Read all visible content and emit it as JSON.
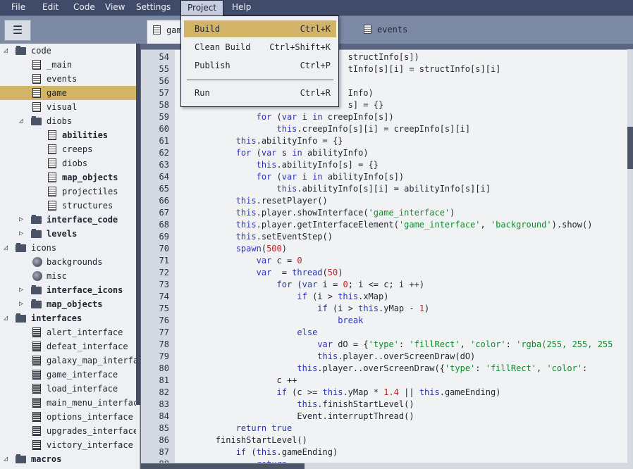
{
  "menubar": {
    "items": [
      "File",
      "Edit",
      "Code",
      "View",
      "Settings",
      "Project",
      "Help"
    ],
    "open": "Project"
  },
  "toolbar": {
    "menu_icon": "☰"
  },
  "tabs": [
    {
      "label": "gam"
    },
    {
      "label": "es"
    },
    {
      "label": "events"
    }
  ],
  "project_menu": {
    "items": [
      {
        "label": "Build",
        "shortcut": "Ctrl+K"
      },
      {
        "label": "Clean Build",
        "shortcut": "Ctrl+Shift+K"
      },
      {
        "label": "Publish",
        "shortcut": "Ctrl+P"
      },
      {
        "label": "Run",
        "shortcut": "Ctrl+R"
      }
    ]
  },
  "sidebar": {
    "items": [
      {
        "label": "code",
        "kind": "folder",
        "expanded": true,
        "bold": false
      },
      {
        "label": "_main",
        "kind": "file"
      },
      {
        "label": "events",
        "kind": "file"
      },
      {
        "label": "game",
        "kind": "file",
        "selected": true
      },
      {
        "label": "visual",
        "kind": "file"
      },
      {
        "label": "diobs",
        "kind": "folder",
        "expanded": true
      },
      {
        "label": "abilities",
        "kind": "file",
        "bold": true
      },
      {
        "label": "creeps",
        "kind": "file"
      },
      {
        "label": "diobs",
        "kind": "file"
      },
      {
        "label": "map_objects",
        "kind": "file",
        "bold": true
      },
      {
        "label": "projectiles",
        "kind": "file"
      },
      {
        "label": "structures",
        "kind": "file"
      },
      {
        "label": "interface_code",
        "kind": "folder",
        "expanded": false,
        "bold": true
      },
      {
        "label": "levels",
        "kind": "folder",
        "expanded": false,
        "bold": true
      },
      {
        "label": "icons",
        "kind": "folder",
        "expanded": true
      },
      {
        "label": "backgrounds",
        "kind": "image"
      },
      {
        "label": "misc",
        "kind": "image"
      },
      {
        "label": "interface_icons",
        "kind": "folder",
        "expanded": false,
        "bold": true
      },
      {
        "label": "map_objects",
        "kind": "folder",
        "expanded": false,
        "bold": true
      },
      {
        "label": "interfaces",
        "kind": "folder",
        "expanded": true,
        "bold": true
      },
      {
        "label": "alert_interface",
        "kind": "iface"
      },
      {
        "label": "defeat_interface",
        "kind": "iface"
      },
      {
        "label": "galaxy_map_interface",
        "kind": "iface"
      },
      {
        "label": "game_interface",
        "kind": "iface"
      },
      {
        "label": "load_interface",
        "kind": "iface"
      },
      {
        "label": "main_menu_interface",
        "kind": "iface"
      },
      {
        "label": "options_interface",
        "kind": "iface"
      },
      {
        "label": "upgrades_interface",
        "kind": "iface"
      },
      {
        "label": "victory_interface",
        "kind": "iface"
      },
      {
        "label": "macros",
        "kind": "folder",
        "expanded": true,
        "bold": true
      }
    ]
  },
  "editor": {
    "lines": [
      {
        "n": "54",
        "t": "                                  structInfo[s])"
      },
      {
        "n": "55",
        "t": "                                  tInfo[s][i] = structInfo[s][i]"
      },
      {
        "n": "56",
        "t": ""
      },
      {
        "n": "57",
        "t": "                                  Info)"
      },
      {
        "n": "58",
        "t": "                                  s] = {}"
      },
      {
        "n": "59",
        "t": "                for (var i in creepInfo[s])"
      },
      {
        "n": "60",
        "t": "                    this.creepInfo[s][i] = creepInfo[s][i]"
      },
      {
        "n": "61",
        "t": "            this.abilityInfo = {}"
      },
      {
        "n": "62",
        "t": "            for (var s in abilityInfo)"
      },
      {
        "n": "63",
        "t": "                this.abilityInfo[s] = {}"
      },
      {
        "n": "64",
        "t": "                for (var i in abilityInfo[s])"
      },
      {
        "n": "65",
        "t": "                    this.abilityInfo[s][i] = abilityInfo[s][i]"
      },
      {
        "n": "66",
        "t": "            this.resetPlayer()"
      },
      {
        "n": "67",
        "t": "            this.player.showInterface('game_interface')"
      },
      {
        "n": "68",
        "t": "            this.player.getInterfaceElement('game_interface', 'background').show()"
      },
      {
        "n": "69",
        "t": "            this.setEventStep()"
      },
      {
        "n": "70",
        "t": "            spawn(500)"
      },
      {
        "n": "71",
        "t": "                var c = 0"
      },
      {
        "n": "72",
        "t": "                var t2 = thread(50)"
      },
      {
        "n": "73",
        "t": "                    for (var i = 0; i <= c; i ++)"
      },
      {
        "n": "74",
        "t": "                        if (i > this.xMap)"
      },
      {
        "n": "75",
        "t": "                            if (i > this.yMap - 1)"
      },
      {
        "n": "76",
        "t": "                                break"
      },
      {
        "n": "77",
        "t": "                        else"
      },
      {
        "n": "78",
        "t": "                            var dO = {'type': 'fillRect', 'color': 'rgba(255, 255, 255"
      },
      {
        "n": "79",
        "t": "                            this.player.back1.overScreenDraw(dO)"
      },
      {
        "n": "80",
        "t": "                        this.player.back1.overScreenDraw({'type': 'fillRect', 'color':"
      },
      {
        "n": "81",
        "t": "                    c ++"
      },
      {
        "n": "82",
        "t": "                    if (c >= this.yMap * 1.4 || this.gameEnding)"
      },
      {
        "n": "83",
        "t": "                        this.finishStartLevel()"
      },
      {
        "n": "84",
        "t": "                        Event.interruptThread(t2)"
      },
      {
        "n": "85",
        "t": "            return true"
      },
      {
        "n": "86",
        "t": "        finishStartLevel()"
      },
      {
        "n": "87",
        "t": "            if (this.gameEnding)"
      },
      {
        "n": "88",
        "t": "                return"
      }
    ]
  }
}
